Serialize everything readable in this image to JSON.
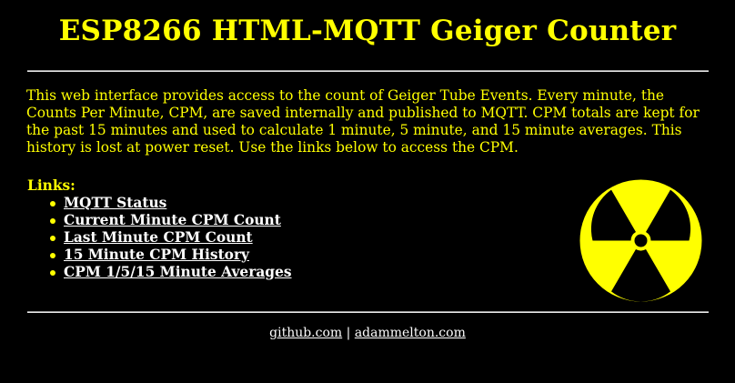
{
  "header": {
    "title": "ESP8266 HTML-MQTT Geiger Counter"
  },
  "intro": {
    "text": "This web interface provides access to the count of Geiger Tube Events. Every minute, the Counts Per Minute, CPM, are saved internally and published to MQTT. CPM totals are kept for the past 15 minutes and used to calculate 1 minute, 5 minute, and 15 minute averages. This history is lost at power reset. Use the links below to access the CPM."
  },
  "links": {
    "heading": "Links:",
    "items": [
      {
        "label": "MQTT Status"
      },
      {
        "label": "Current Minute CPM Count"
      },
      {
        "label": "Last Minute CPM Count"
      },
      {
        "label": "15 Minute CPM History"
      },
      {
        "label": "CPM 1/5/15 Minute Averages"
      }
    ]
  },
  "footer": {
    "link1": "github.com",
    "separator": "|",
    "link2": "adammelton.com"
  },
  "icons": {
    "radiation": "radiation-trefoil-icon"
  },
  "colors": {
    "background": "#000000",
    "text": "#ffff00",
    "link": "#ffffff"
  }
}
